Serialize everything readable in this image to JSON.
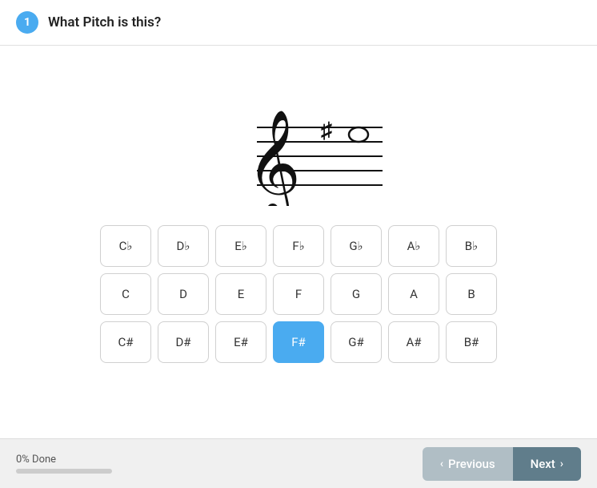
{
  "header": {
    "question_number": "1",
    "question_title": "What Pitch is this?"
  },
  "answer_rows": [
    [
      {
        "label": "C♭",
        "id": "cb",
        "selected": false
      },
      {
        "label": "D♭",
        "id": "db",
        "selected": false
      },
      {
        "label": "E♭",
        "id": "eb",
        "selected": false
      },
      {
        "label": "F♭",
        "id": "fb",
        "selected": false
      },
      {
        "label": "G♭",
        "id": "gb",
        "selected": false
      },
      {
        "label": "A♭",
        "id": "ab",
        "selected": false
      },
      {
        "label": "B♭",
        "id": "bb",
        "selected": false
      }
    ],
    [
      {
        "label": "C",
        "id": "c",
        "selected": false
      },
      {
        "label": "D",
        "id": "d",
        "selected": false
      },
      {
        "label": "E",
        "id": "e",
        "selected": false
      },
      {
        "label": "F",
        "id": "f",
        "selected": false
      },
      {
        "label": "G",
        "id": "g",
        "selected": false
      },
      {
        "label": "A",
        "id": "a",
        "selected": false
      },
      {
        "label": "B",
        "id": "b",
        "selected": false
      }
    ],
    [
      {
        "label": "C#",
        "id": "cs",
        "selected": false
      },
      {
        "label": "D#",
        "id": "ds",
        "selected": false
      },
      {
        "label": "E#",
        "id": "es",
        "selected": false
      },
      {
        "label": "F#",
        "id": "fs",
        "selected": true
      },
      {
        "label": "G#",
        "id": "gs",
        "selected": false
      },
      {
        "label": "A#",
        "id": "as",
        "selected": false
      },
      {
        "label": "B#",
        "id": "bs",
        "selected": false
      }
    ]
  ],
  "footer": {
    "progress_label": "0% Done",
    "progress_percent": 0,
    "prev_label": "Previous",
    "next_label": "Next"
  }
}
